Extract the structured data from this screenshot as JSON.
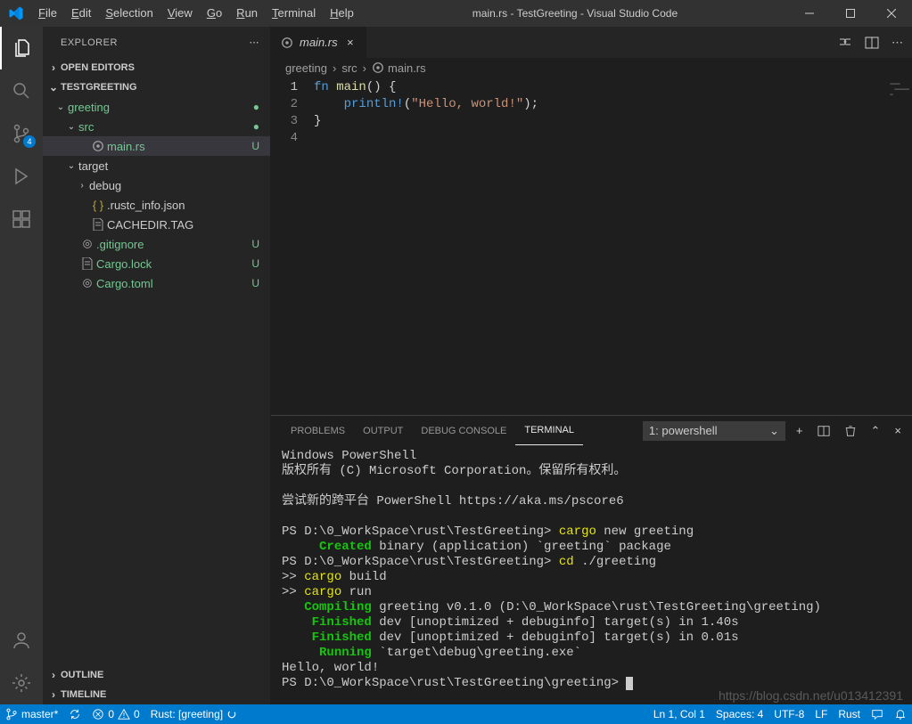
{
  "window": {
    "title": "main.rs - TestGreeting - Visual Studio Code"
  },
  "menu": {
    "file": "File",
    "edit": "Edit",
    "selection": "Selection",
    "view": "View",
    "go": "Go",
    "run": "Run",
    "terminal": "Terminal",
    "help": "Help"
  },
  "activity": {
    "badge_scm": "4"
  },
  "sidebar": {
    "title": "EXPLORER",
    "open_editors": "OPEN EDITORS",
    "workspace": "TESTGREETING",
    "outline": "OUTLINE",
    "timeline": "TIMELINE",
    "tree": {
      "greeting": "greeting",
      "src": "src",
      "main_rs": "main.rs",
      "main_rs_status": "U",
      "target": "target",
      "debug": "debug",
      "rustc_info": ".rustc_info.json",
      "cachedir": "CACHEDIR.TAG",
      "gitignore": ".gitignore",
      "gitignore_status": "U",
      "cargo_lock": "Cargo.lock",
      "cargo_lock_status": "U",
      "cargo_toml": "Cargo.toml",
      "cargo_toml_status": "U"
    }
  },
  "editor": {
    "tab_label": "main.rs",
    "breadcrumbs": {
      "p1": "greeting",
      "p2": "src",
      "p3": "main.rs"
    },
    "code": {
      "l1_fn": "fn",
      "l1_main": " main",
      "l1_rest": "() {",
      "l2_indent": "    ",
      "l2_mac": "println!",
      "l2_open": "(",
      "l2_str": "\"Hello, world!\"",
      "l2_close": ");",
      "l3": "}",
      "ln1": "1",
      "ln2": "2",
      "ln3": "3",
      "ln4": "4"
    }
  },
  "panel": {
    "tabs": {
      "problems": "PROBLEMS",
      "output": "OUTPUT",
      "debug_console": "DEBUG CONSOLE",
      "terminal": "TERMINAL"
    },
    "shell_select": "1: powershell",
    "terminal_lines": [
      {
        "t": "Windows PowerShell"
      },
      {
        "t": "版权所有 (C) Microsoft Corporation。保留所有权利。"
      },
      {
        "t": ""
      },
      {
        "t": "尝试新的跨平台 PowerShell https://aka.ms/pscore6"
      },
      {
        "t": ""
      },
      {
        "segs": [
          {
            "t": "PS D:\\0_WorkSpace\\rust\\TestGreeting> "
          },
          {
            "t": "cargo",
            "c": "term-yellow"
          },
          {
            "t": " new greeting"
          }
        ]
      },
      {
        "segs": [
          {
            "t": "     "
          },
          {
            "t": "Created",
            "c": "term-green term-bold"
          },
          {
            "t": " binary (application) `greeting` package"
          }
        ]
      },
      {
        "segs": [
          {
            "t": "PS D:\\0_WorkSpace\\rust\\TestGreeting> "
          },
          {
            "t": "cd",
            "c": "term-yellow"
          },
          {
            "t": " ./greeting"
          }
        ]
      },
      {
        "segs": [
          {
            "t": ">> "
          },
          {
            "t": "cargo",
            "c": "term-yellow"
          },
          {
            "t": " build"
          }
        ]
      },
      {
        "segs": [
          {
            "t": ">> "
          },
          {
            "t": "cargo",
            "c": "term-yellow"
          },
          {
            "t": " run"
          }
        ]
      },
      {
        "segs": [
          {
            "t": "   "
          },
          {
            "t": "Compiling",
            "c": "term-green term-bold"
          },
          {
            "t": " greeting v0.1.0 (D:\\0_WorkSpace\\rust\\TestGreeting\\greeting)"
          }
        ]
      },
      {
        "segs": [
          {
            "t": "    "
          },
          {
            "t": "Finished",
            "c": "term-green term-bold"
          },
          {
            "t": " dev [unoptimized + debuginfo] target(s) in 1.40s"
          }
        ]
      },
      {
        "segs": [
          {
            "t": "    "
          },
          {
            "t": "Finished",
            "c": "term-green term-bold"
          },
          {
            "t": " dev [unoptimized + debuginfo] target(s) in 0.01s"
          }
        ]
      },
      {
        "segs": [
          {
            "t": "     "
          },
          {
            "t": "Running",
            "c": "term-green term-bold"
          },
          {
            "t": " `target\\debug\\greeting.exe`"
          }
        ]
      },
      {
        "t": "Hello, world!"
      },
      {
        "segs": [
          {
            "t": "PS D:\\0_WorkSpace\\rust\\TestGreeting\\greeting> "
          },
          {
            "cursor": true
          }
        ]
      }
    ]
  },
  "statusbar": {
    "branch": "master*",
    "errors": "0",
    "warnings": "0",
    "rust": "Rust: [greeting]",
    "lncol": "Ln 1, Col 1",
    "spaces": "Spaces: 4",
    "encoding": "UTF-8",
    "eol": "LF",
    "lang": "Rust"
  },
  "watermark": "https://blog.csdn.net/u013412391"
}
